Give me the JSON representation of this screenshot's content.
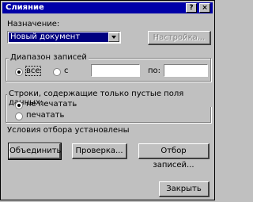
{
  "window": {
    "title": "Слияние",
    "help_button": "?",
    "close_button": "×"
  },
  "purpose": {
    "label": "Назначение:",
    "selected": "Новый документ",
    "setup_button": "Настройка..."
  },
  "range": {
    "label": "Диапазон записей",
    "option_all": "все",
    "option_from": "с",
    "to_label": "по:",
    "from_value": "",
    "to_value": ""
  },
  "empty_fields": {
    "label": "Строки, содержащие только пустые поля данных:",
    "option_no_print": "не печатать",
    "option_print": "печатать"
  },
  "status_text": "Условия отбора установлены",
  "buttons": {
    "merge": "Объединить",
    "check": "Проверка...",
    "query": "Отбор записей...",
    "close": "Закрыть"
  }
}
